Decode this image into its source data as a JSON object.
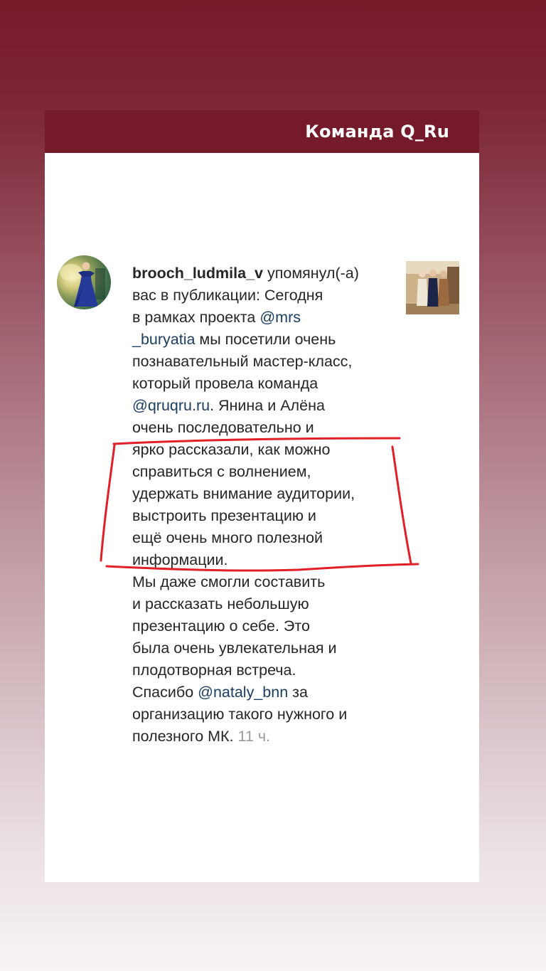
{
  "story": {
    "header_title": "Команда Q_Ru"
  },
  "notification": {
    "username": "brooch_ludmila_v",
    "text_before_mention_1": " упомянул(-а)\nвас в публикации: Сегодня\nв рамках проекта ",
    "mention_1": "@mrs\n_buryatia",
    "text_after_mention_1": " мы посетили очень\nпознавательный мастер-класс,\nкоторый провела команда\n",
    "mention_2": "@qruqru.ru",
    "text_after_mention_2": ". Янина и Алёна\nочень последовательно и\nярко рассказали, как можно\nсправиться с волнением,\nудержать внимание аудитории,\nвыстроить презентацию и\nещё очень много полезной\nинформации.\nМы даже смогли составить\nи рассказать небольшую\nпрезентацию о себе. Это\nбыла очень увлекательная и\nплодотворная встреча.\nСпасибо ",
    "mention_3": "@nataly_bnn",
    "text_after_mention_3": " за\nорганизацию такого нужного и\nполезного  МК. ",
    "time_ago": "11 ч."
  },
  "colors": {
    "header_background": "#751a2b",
    "mention_color": "#1b3e62",
    "annotation_red": "#e01f26",
    "time_color": "#9a9a9a"
  },
  "icons": {
    "avatar": "profile-photo-woman-blue-dress",
    "post_thumbnail": "post-photo-three-women"
  }
}
